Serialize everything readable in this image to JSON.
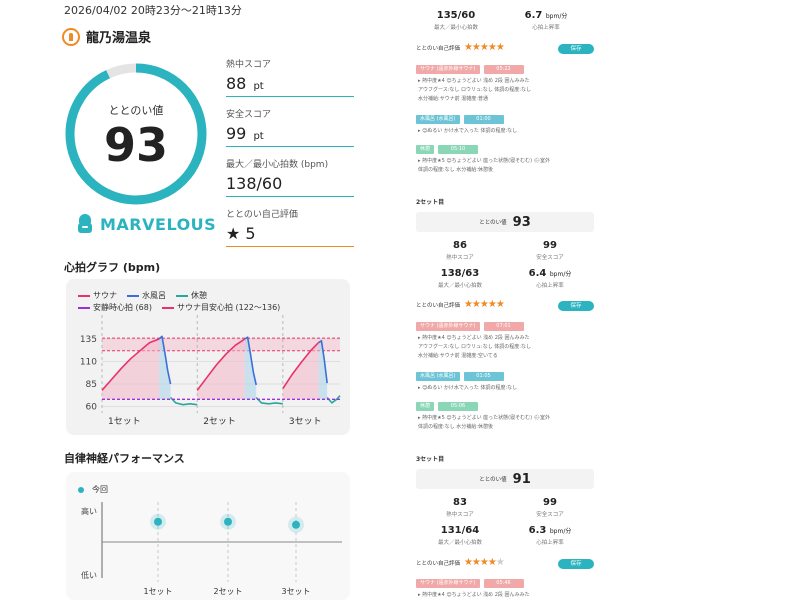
{
  "header": {
    "datetime": "2026/04/02 20時23分～21時13分",
    "facility": "龍乃湯温泉"
  },
  "gauge": {
    "label": "ととのい値",
    "value": "93",
    "fraction": 0.93,
    "badge": "MARVELOUS",
    "color": "#2bb3c0"
  },
  "metrics": [
    {
      "label": "熱中スコア",
      "value": "88",
      "unit": "pt"
    },
    {
      "label": "安全スコア",
      "value": "99",
      "unit": "pt"
    },
    {
      "label": "最大／最小心拍数 (bpm)",
      "value": "138/60",
      "unit": ""
    },
    {
      "label": "ととのい自己評価",
      "value": "★ 5",
      "unit": ""
    }
  ],
  "hr_section_title": "心拍グラフ (bpm)",
  "hr_legend": {
    "sauna": "サウナ",
    "water": "水風呂",
    "rest": "休憩",
    "resting": "安静時心拍 (68)",
    "target": "サウナ目安心拍 (122～136)"
  },
  "chart_data": {
    "type": "line",
    "title": "心拍グラフ (bpm)",
    "ylabel": "",
    "xlabel": "",
    "yticks": [
      60,
      85,
      110,
      135
    ],
    "ylim": [
      55,
      155
    ],
    "xlim": [
      0,
      50
    ],
    "set_labels": [
      "1セット",
      "2セット",
      "3セット"
    ],
    "resting_hr": 68,
    "target_band": [
      122,
      136
    ],
    "colors": {
      "sauna": "#e8336a",
      "water": "#3b6fd8",
      "rest": "#2aa6a0",
      "resting": "#9b30d9",
      "target": "#e8336a"
    },
    "series": [
      {
        "name": "サウナ",
        "phase": "sauna",
        "x": [
          0,
          2,
          4,
          6,
          8,
          10,
          12
        ],
        "y": [
          78,
          90,
          102,
          113,
          122,
          131,
          135
        ]
      },
      {
        "name": "水風呂",
        "phase": "water",
        "x": [
          12,
          12.6,
          13.2,
          13.8,
          14.4
        ],
        "y": [
          135,
          138,
          120,
          100,
          85
        ]
      },
      {
        "name": "休憩",
        "phase": "rest",
        "x": [
          14.4,
          15.5,
          17,
          18.5,
          20
        ],
        "y": [
          70,
          64,
          62,
          63,
          62
        ]
      },
      {
        "name": "サウナ",
        "phase": "sauna",
        "x": [
          20,
          22,
          24,
          26,
          28,
          30
        ],
        "y": [
          78,
          92,
          106,
          118,
          128,
          135
        ]
      },
      {
        "name": "水風呂",
        "phase": "water",
        "x": [
          30,
          30.6,
          31.2,
          31.8,
          32.4
        ],
        "y": [
          135,
          137,
          118,
          98,
          84
        ]
      },
      {
        "name": "休憩",
        "phase": "rest",
        "x": [
          32.4,
          33.5,
          35,
          36.5,
          38
        ],
        "y": [
          70,
          64,
          63,
          64,
          63
        ]
      },
      {
        "name": "サウナ",
        "phase": "sauna",
        "x": [
          38,
          40,
          42,
          44,
          45.5
        ],
        "y": [
          80,
          96,
          110,
          123,
          131
        ]
      },
      {
        "name": "水風呂",
        "phase": "water",
        "x": [
          45.5,
          46.1,
          46.7,
          47.3
        ],
        "y": [
          131,
          133,
          112,
          86
        ]
      },
      {
        "name": "休憩",
        "phase": "rest",
        "x": [
          47.3,
          48.3,
          49.3,
          50
        ],
        "y": [
          70,
          64,
          68,
          72
        ]
      }
    ]
  },
  "perf": {
    "title": "自律神経パフォーマンス",
    "legend": "今回",
    "y_high": "高い",
    "y_low": "低い",
    "categories": [
      "1セット",
      "2セット",
      "3セット"
    ],
    "values": [
      0.74,
      0.74,
      0.7
    ]
  },
  "right": {
    "top_stats": [
      {
        "value": "135/60",
        "unit": "",
        "label": "最大／最小心拍数"
      },
      {
        "value": "6.7",
        "unit": "bpm/分",
        "label": "心拍上昇率"
      }
    ],
    "rating_label": "ととのい自己評価",
    "rating_stars_1": "★★★★★",
    "rating_stars_2": "★★★★★",
    "rating_stars_3_on": "★★★★",
    "rating_stars_3_off": "★",
    "btn": "保存",
    "set1_phases": [
      {
        "type": "sauna",
        "name": "サウナ (遠赤外線サウナ)",
        "time": "05:22"
      },
      {
        "type": "water",
        "name": "水風呂 (水風呂)",
        "time": "01:00"
      },
      {
        "type": "rest",
        "name": "休憩",
        "time": "05:10"
      }
    ],
    "set1_tags": [
      "▸ 熱中度★4 😊ちょうどよい 浅め 2段 囲んみみた",
      "アウフグース:なし ロウリュ:なし 体調の程度:なし",
      "水分補給:サウナ前 混雑度:普通",
      "▸ 😊ぬるい かけ水で入った 体調の程度:なし",
      "▸ 熱中度★5 😊ちょうどよい 座った状態(寝そむむ) 🌧室外",
      "体調の程度:なし 水分補給:休憩後"
    ],
    "set2_label": "2セット目",
    "set2_totonoi_label": "ととのい値",
    "set2_value": "93",
    "set2_stats": [
      {
        "value": "86",
        "unit": "",
        "label": "熱中スコア"
      },
      {
        "value": "99",
        "unit": "",
        "label": "安全スコア"
      },
      {
        "value": "138/63",
        "unit": "",
        "label": "最大／最小心拍数"
      },
      {
        "value": "6.4",
        "unit": "bpm/分",
        "label": "心拍上昇率"
      }
    ],
    "set2_phases": [
      {
        "type": "sauna",
        "name": "サウナ (遠赤外線サウナ)",
        "time": "07:01"
      },
      {
        "type": "water",
        "name": "水風呂 (水風呂)",
        "time": "01:05"
      },
      {
        "type": "rest",
        "name": "休憩",
        "time": "05:06"
      }
    ],
    "set2_tags": [
      "▸ 熱中度★4 😊ちょうどよい 浅め 2段 囲んみみた",
      "アウフグース:なし ロウリュ:なし 体調の程度:なし",
      "水分補給:サウナ前 混雑度:空いてる",
      "▸ 😊ぬるい かけ水で入った 体調の程度:なし",
      "▸ 熱中度★5 😊ちょうどよい 座った状態(寝そむむ) 🌧室外",
      "体調の程度:なし 水分補給:休憩後"
    ],
    "set3_label": "3セット目",
    "set3_totonoi_label": "ととのい値",
    "set3_value": "91",
    "set3_stats": [
      {
        "value": "83",
        "unit": "",
        "label": "熱中スコア"
      },
      {
        "value": "99",
        "unit": "",
        "label": "安全スコア"
      },
      {
        "value": "131/64",
        "unit": "",
        "label": "最大／最小心拍数"
      },
      {
        "value": "6.3",
        "unit": "bpm/分",
        "label": "心拍上昇率"
      }
    ],
    "set3_phases": [
      {
        "type": "sauna",
        "name": "サウナ (遠赤外線サウナ)",
        "time": "05:46"
      }
    ],
    "set3_tags": [
      "▸ 熱中度★4 😊ちょうどよい 浅め 2段 囲んみみた"
    ]
  }
}
